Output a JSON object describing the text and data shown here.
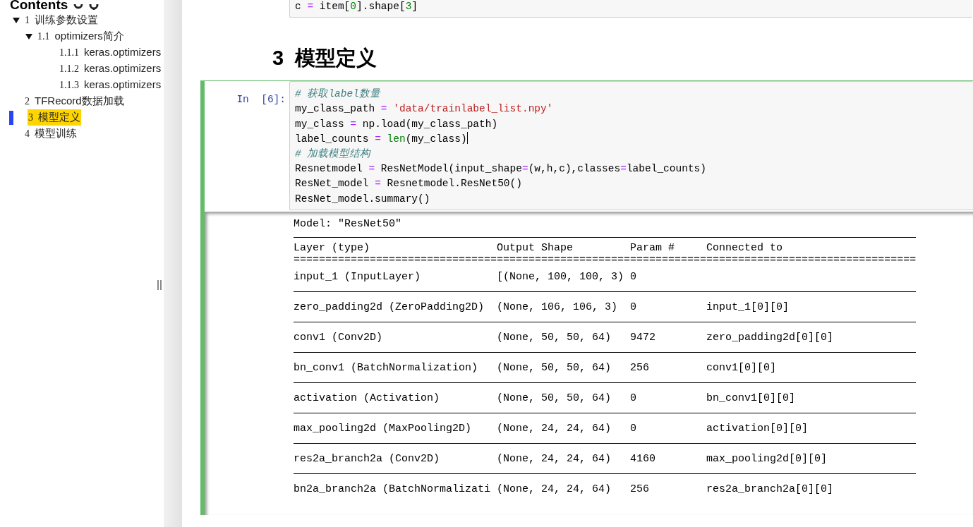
{
  "sidebar": {
    "title": "Contents",
    "items": [
      {
        "number": "1",
        "label": "训练参数设置",
        "expanded": true,
        "selected": false,
        "children": [
          {
            "number": "1.1",
            "label": "optimizers简介",
            "expanded": true,
            "selected": false,
            "children": [
              {
                "number": "1.1.1",
                "label": "keras.optimizers",
                "selected": false
              },
              {
                "number": "1.1.2",
                "label": "keras.optimizers",
                "selected": false
              },
              {
                "number": "1.1.3",
                "label": "keras.optimizers",
                "selected": false
              }
            ]
          }
        ]
      },
      {
        "number": "2",
        "label": "TFRecord数据加载",
        "selected": false
      },
      {
        "number": "3",
        "label": "模型定义",
        "selected": true
      },
      {
        "number": "4",
        "label": "模型训练",
        "selected": false
      }
    ]
  },
  "cells": [
    {
      "kind": "code",
      "selected": false,
      "lines": [
        {
          "tokens": [
            {
              "text": "c ",
              "kind": "plain"
            },
            {
              "text": "=",
              "kind": "op"
            },
            {
              "text": " item[",
              "kind": "plain"
            },
            {
              "text": "0",
              "kind": "num"
            },
            {
              "text": "].shape[",
              "kind": "plain"
            },
            {
              "text": "3",
              "kind": "num"
            },
            {
              "text": "]",
              "kind": "plain"
            }
          ]
        }
      ]
    },
    {
      "kind": "heading",
      "number": "3",
      "text": "模型定义"
    },
    {
      "kind": "code",
      "selected": true,
      "prompt": "In  [6]:",
      "lines": [
        {
          "tokens": [
            {
              "text": "# 获取label数量",
              "kind": "comment"
            }
          ]
        },
        {
          "tokens": [
            {
              "text": "my_class_path ",
              "kind": "plain"
            },
            {
              "text": "= ",
              "kind": "op"
            },
            {
              "text": "'data/trainlabel_list.npy'",
              "kind": "str"
            }
          ]
        },
        {
          "tokens": [
            {
              "text": "my_class ",
              "kind": "plain"
            },
            {
              "text": "=",
              "kind": "op"
            },
            {
              "text": " np.load(my_class_path)",
              "kind": "plain"
            }
          ]
        },
        {
          "cursor": true,
          "tokens": [
            {
              "text": "label_counts ",
              "kind": "plain"
            },
            {
              "text": "= ",
              "kind": "op"
            },
            {
              "text": "len",
              "kind": "builtin"
            },
            {
              "text": "(my_class)",
              "kind": "plain"
            }
          ]
        },
        {
          "tokens": [
            {
              "text": "# 加载模型结构",
              "kind": "comment"
            }
          ]
        },
        {
          "tokens": [
            {
              "text": "Resnetmodel ",
              "kind": "plain"
            },
            {
              "text": "=",
              "kind": "op"
            },
            {
              "text": " ResNetModel(input_shape",
              "kind": "plain"
            },
            {
              "text": "=",
              "kind": "op"
            },
            {
              "text": "(w,h,c),classes",
              "kind": "plain"
            },
            {
              "text": "=",
              "kind": "op"
            },
            {
              "text": "label_counts)",
              "kind": "plain"
            }
          ]
        },
        {
          "tokens": [
            {
              "text": "ResNet_model ",
              "kind": "plain"
            },
            {
              "text": "=",
              "kind": "op"
            },
            {
              "text": " Resnetmodel.ResNet50()",
              "kind": "plain"
            }
          ]
        },
        {
          "tokens": [
            {
              "text": "ResNet_model.summary()",
              "kind": "plain"
            }
          ]
        }
      ],
      "output": {
        "model_line": "Model: \"ResNet50\"",
        "columns": [
          "Layer (type)",
          "Output Shape",
          "Param #",
          "Connected to"
        ],
        "separator": "==================================================================================================",
        "rows": [
          [
            "input_1 (InputLayer)",
            "[(None, 100, 100, 3)",
            "0",
            ""
          ],
          [
            "zero_padding2d (ZeroPadding2D)",
            "(None, 106, 106, 3)",
            "0",
            "input_1[0][0]"
          ],
          [
            "conv1 (Conv2D)",
            "(None, 50, 50, 64)",
            "9472",
            "zero_padding2d[0][0]"
          ],
          [
            "bn_conv1 (BatchNormalization)",
            "(None, 50, 50, 64)",
            "256",
            "conv1[0][0]"
          ],
          [
            "activation (Activation)",
            "(None, 50, 50, 64)",
            "0",
            "bn_conv1[0][0]"
          ],
          [
            "max_pooling2d (MaxPooling2D)",
            "(None, 24, 24, 64)",
            "0",
            "activation[0][0]"
          ],
          [
            "res2a_branch2a (Conv2D)",
            "(None, 24, 24, 64)",
            "4160",
            "max_pooling2d[0][0]"
          ],
          [
            "bn2a_branch2a (BatchNormalizati",
            "(None, 24, 24, 64)",
            "256",
            "res2a_branch2a[0][0]"
          ]
        ]
      }
    }
  ]
}
